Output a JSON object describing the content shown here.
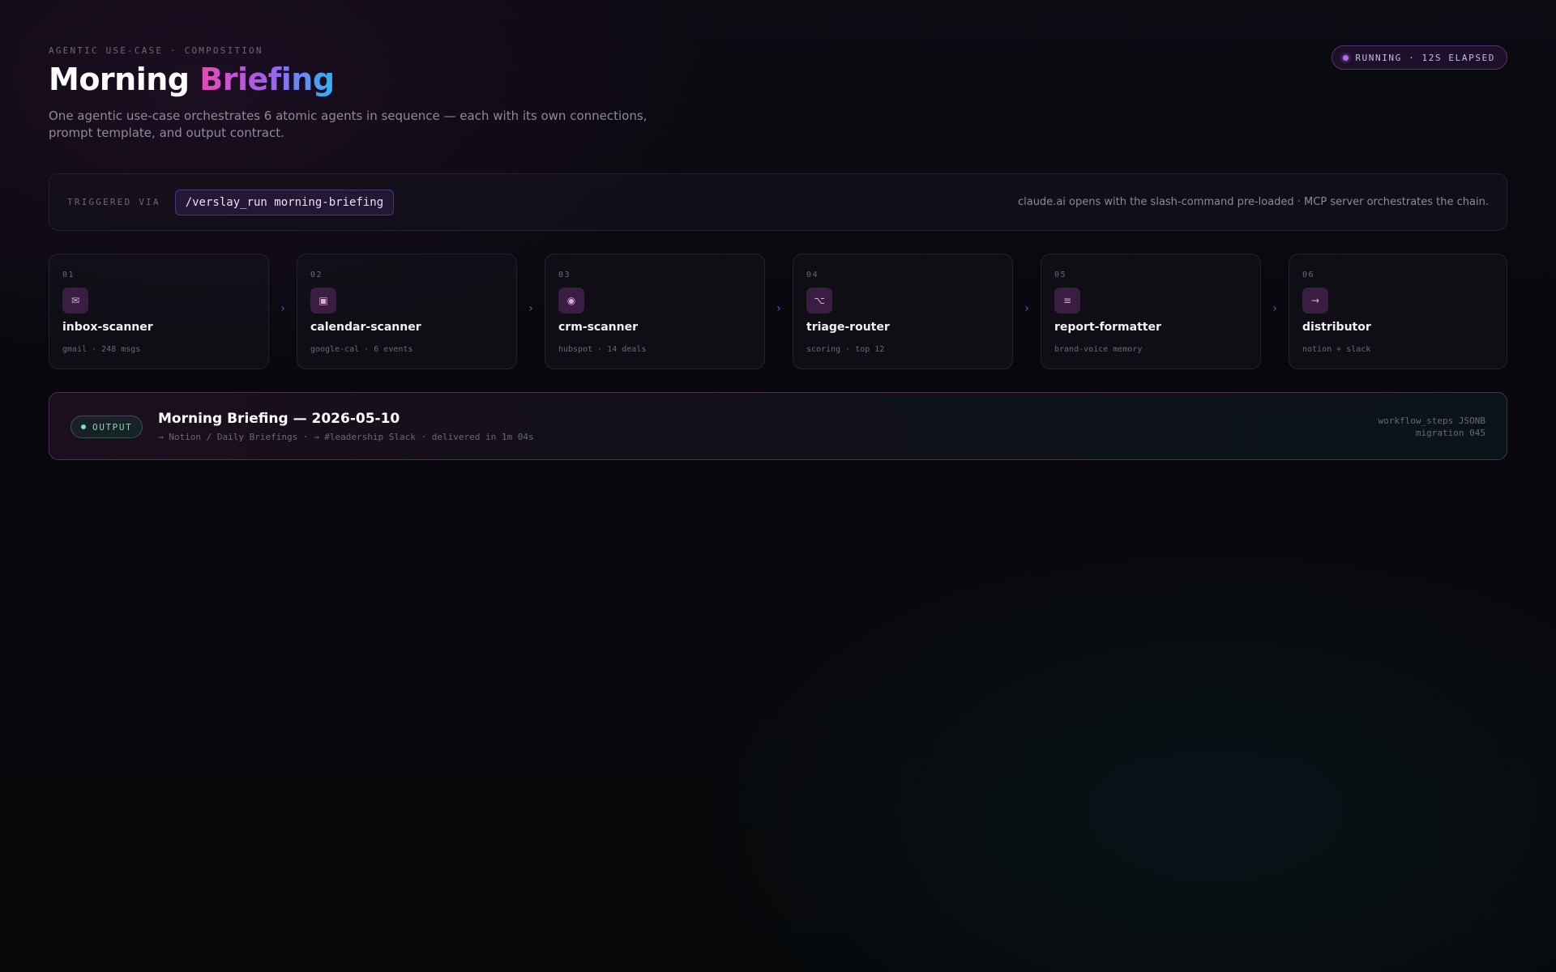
{
  "header": {
    "eyebrow": "AGENTIC USE-CASE · COMPOSITION",
    "title_main": "Morning",
    "title_accent": "Briefing",
    "subtitle": "One agentic use-case orchestrates 6 atomic agents in sequence — each with its own connections, prompt template, and output contract."
  },
  "status": {
    "label": "RUNNING · 12S ELAPSED"
  },
  "trigger": {
    "label": "TRIGGERED VIA",
    "command": "/verslay_run morning-briefing",
    "note": "claude.ai opens with the slash-command pre-loaded · MCP server orchestrates the chain."
  },
  "steps": [
    {
      "num": "01",
      "icon": "mail-icon",
      "glyph": "✉",
      "name": "inbox-scanner",
      "meta": "gmail · 248 msgs"
    },
    {
      "num": "02",
      "icon": "calendar-icon",
      "glyph": "▣",
      "name": "calendar-scanner",
      "meta": "google-cal · 6 events"
    },
    {
      "num": "03",
      "icon": "target-icon",
      "glyph": "◉",
      "name": "crm-scanner",
      "meta": "hubspot · 14 deals"
    },
    {
      "num": "04",
      "icon": "branch-icon",
      "glyph": "⌥",
      "name": "triage-router",
      "meta": "scoring · top 12"
    },
    {
      "num": "05",
      "icon": "lines-icon",
      "glyph": "≡",
      "name": "report-formatter",
      "meta": "brand-voice memory"
    },
    {
      "num": "06",
      "icon": "arrow-right-icon",
      "glyph": "→",
      "name": "distributor",
      "meta": "notion + slack"
    }
  ],
  "step_arrow_glyph": "›",
  "output": {
    "badge": "OUTPUT",
    "title": "Morning Briefing — 2026-05-10",
    "path": "→ Notion / Daily Briefings · → #leadership Slack · delivered in 1m 04s",
    "meta_line1": "workflow_steps JSONB",
    "meta_line2": "migration 045"
  },
  "colors": {
    "accent_pink": "#e54bb5",
    "accent_purple": "#a45cf0",
    "accent_blue": "#2fb5f0",
    "running": "#b06cf0",
    "output_green": "#7fe0b5"
  }
}
